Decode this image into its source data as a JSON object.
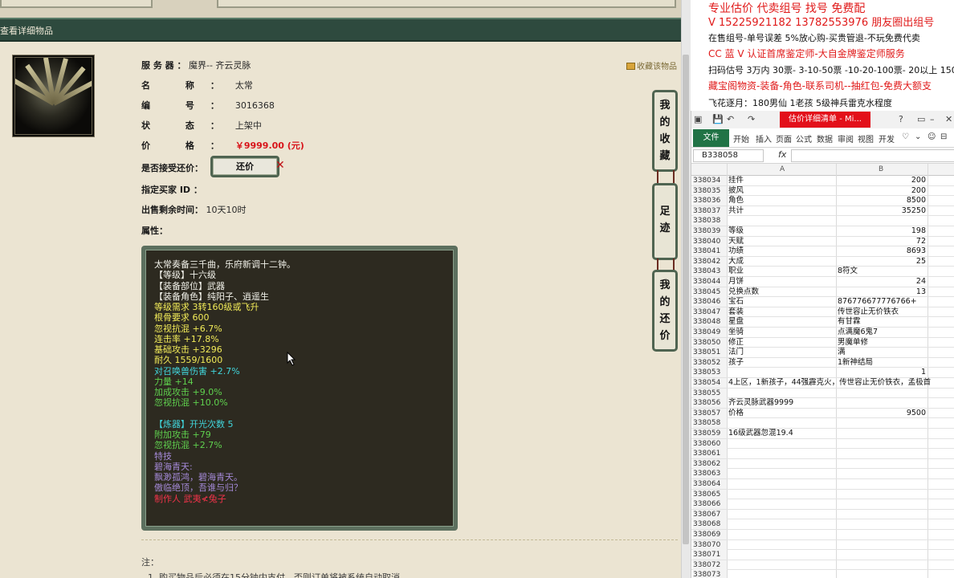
{
  "page": {
    "header_title": "查看详细物品",
    "favorite_link": "收藏该物品",
    "fields": [
      {
        "label": "服 务 器 ：",
        "value": "魔界-- 齐云灵脉"
      },
      {
        "label": "名 称：",
        "value": "太常"
      },
      {
        "label": "编 号：",
        "value": "3016368"
      },
      {
        "label": "状 态：",
        "value": "上架中"
      },
      {
        "label": "价 格：",
        "value": "￥9999.00 (元)"
      }
    ],
    "counter_label": "是否接受还价：",
    "counter_button": "还价",
    "buyer_label": "指定买家 ID ：",
    "remaining_label": "出售剩余时间：",
    "remaining_value": "10天10时",
    "attr_label": "属性：",
    "side_buttons": [
      "我的收藏",
      "足迹",
      "我的还价"
    ],
    "note_label": "注：",
    "note_1": "1. 购买物品后必须在15分钟内支付，否则订单将被系统自动取消。",
    "props": [
      {
        "t": "太常奏备三千曲，乐府新调十二钟。",
        "c": "w"
      },
      {
        "t": "【等级】十六级",
        "c": "w"
      },
      {
        "t": "【装备部位】武器",
        "c": "w"
      },
      {
        "t": "【装备角色】纯阳子、逍遥生",
        "c": "w"
      },
      {
        "t": "等级需求 3转160级或飞升",
        "c": "y"
      },
      {
        "t": "根骨要求 600",
        "c": "y"
      },
      {
        "t": "忽视抗混 +6.7%",
        "c": "y"
      },
      {
        "t": "连击率 +17.8%",
        "c": "y"
      },
      {
        "t": "基础攻击 +3296",
        "c": "y"
      },
      {
        "t": "耐久 1559/1600",
        "c": "y"
      },
      {
        "t": "对召唤兽伤害 +2.7%",
        "c": "c"
      },
      {
        "t": "力量 +14",
        "c": "g"
      },
      {
        "t": "加成攻击 +9.0%",
        "c": "g"
      },
      {
        "t": "忽视抗混 +10.0%",
        "c": "g"
      },
      {
        "t": "",
        "c": "w"
      },
      {
        "t": "【炼器】开光次数 5",
        "c": "c"
      },
      {
        "t": "附加攻击 +79",
        "c": "g"
      },
      {
        "t": "忽视抗混 +2.7%",
        "c": "g"
      },
      {
        "t": "特技",
        "c": "p"
      },
      {
        "t": "碧海青天:",
        "c": "p"
      },
      {
        "t": "飘渺孤鸿，碧海青天。",
        "c": "p"
      },
      {
        "t": "傲临绝顶，吾谁与归？",
        "c": "p"
      },
      {
        "t": "制作人 武夷≮兔子",
        "c": "r"
      }
    ]
  },
  "ad": {
    "lines": [
      {
        "t": "专业估价 代卖组号 找号 免费配",
        "c": "red",
        "size": 14
      },
      {
        "t": "V 15225921182   13782553976 朋友圈出组号",
        "c": "red",
        "size": 13
      },
      {
        "t": "在售组号-单号误差 5%放心购-买贵管退-不玩免费代卖",
        "c": "blk",
        "size": 11
      },
      {
        "t": "CC 蓝 V 认证首席鉴定师-大自金牌鉴定师服务",
        "c": "red",
        "size": 12
      },
      {
        "t": "扫码估号 3万内 30票- 3-10-50票  -10-20-100票- 20以上 150",
        "c": "blk",
        "size": 11
      },
      {
        "t": "藏宝阁物资-装备-角色-联系司机--抽红包-免费大额支",
        "c": "red",
        "size": 12
      },
      {
        "t": "飞花逐月：180男仙 1老孩 5级神兵雷克水程度",
        "c": "blk",
        "size": 11
      }
    ]
  },
  "excel": {
    "title": "估价详细清单 - Mi...",
    "file_tab": "文件",
    "tabs": [
      "开始",
      "插入",
      "页面",
      "公式",
      "数据",
      "审阅",
      "视图",
      "开发"
    ],
    "name_box": "B338058",
    "fx": "fx",
    "col_a": "A",
    "col_b": "B",
    "rows": [
      {
        "n": "338034",
        "a": "挂件",
        "b": "200"
      },
      {
        "n": "338035",
        "a": "披风",
        "b": "200"
      },
      {
        "n": "338036",
        "a": "角色",
        "b": "8500"
      },
      {
        "n": "338037",
        "a": "共计",
        "b": "35250"
      },
      {
        "n": "338038",
        "a": "",
        "b": ""
      },
      {
        "n": "338039",
        "a": "等级",
        "b": "198"
      },
      {
        "n": "338040",
        "a": "天赋",
        "b": "72"
      },
      {
        "n": "338041",
        "a": "功绩",
        "b": "8693"
      },
      {
        "n": "338042",
        "a": "大成",
        "b": "25"
      },
      {
        "n": "338043",
        "a": "职业",
        "bl": "8符文"
      },
      {
        "n": "338044",
        "a": "月饼",
        "b": "24"
      },
      {
        "n": "338045",
        "a": "兑换点数",
        "b": "13"
      },
      {
        "n": "338046",
        "a": "宝石",
        "bl": "876776677776766+"
      },
      {
        "n": "338047",
        "a": "套装",
        "bl": "传世容止无价铁衣"
      },
      {
        "n": "338048",
        "a": "星盘",
        "bl": "有甘霖"
      },
      {
        "n": "338049",
        "a": "坐骑",
        "bl": "点满魔6鬼7"
      },
      {
        "n": "338050",
        "a": "修正",
        "bl": "男魔单修"
      },
      {
        "n": "338051",
        "a": "法门",
        "bl": "满"
      },
      {
        "n": "338052",
        "a": "孩子",
        "bl": "1新神结局"
      },
      {
        "n": "338053",
        "a": "",
        "b": "1"
      },
      {
        "n": "338054",
        "a": "4上区，1新孩子，44强霹克火，传世容止无价铁衣，孟极首",
        "b": ""
      },
      {
        "n": "338055",
        "a": "",
        "b": ""
      },
      {
        "n": "338056",
        "a": "齐云灵脉武器9999",
        "b": ""
      },
      {
        "n": "338057",
        "a": "价格",
        "b": "9500"
      },
      {
        "n": "338058",
        "a": "",
        "b": ""
      },
      {
        "n": "338059",
        "a": "16级武器忽混19.4",
        "b": ""
      },
      {
        "n": "338060",
        "a": "",
        "b": ""
      },
      {
        "n": "338061",
        "a": "",
        "b": ""
      },
      {
        "n": "338062",
        "a": "",
        "b": ""
      },
      {
        "n": "338063",
        "a": "",
        "b": ""
      },
      {
        "n": "338064",
        "a": "",
        "b": ""
      },
      {
        "n": "338065",
        "a": "",
        "b": ""
      },
      {
        "n": "338066",
        "a": "",
        "b": ""
      },
      {
        "n": "338067",
        "a": "",
        "b": ""
      },
      {
        "n": "338068",
        "a": "",
        "b": ""
      },
      {
        "n": "338069",
        "a": "",
        "b": ""
      },
      {
        "n": "338070",
        "a": "",
        "b": ""
      },
      {
        "n": "338071",
        "a": "",
        "b": ""
      },
      {
        "n": "338072",
        "a": "",
        "b": ""
      },
      {
        "n": "338073",
        "a": "",
        "b": ""
      }
    ]
  },
  "colors": {
    "header": "#2e4a3e",
    "price": "#d8141a",
    "excel_green": "#217346",
    "ad_red": "#e01a1a"
  }
}
